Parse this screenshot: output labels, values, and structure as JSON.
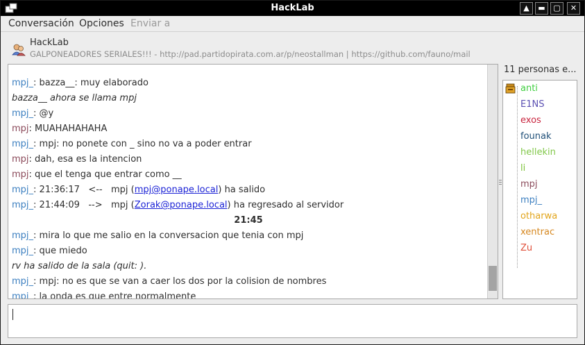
{
  "window": {
    "title": "HackLab",
    "buttons": [
      "▲",
      "▬",
      "▢",
      "✕"
    ]
  },
  "menu": {
    "items": [
      {
        "label": "Conversación",
        "enabled": true
      },
      {
        "label": "Opciones",
        "enabled": true
      },
      {
        "label": "Enviar a",
        "enabled": false
      }
    ]
  },
  "room": {
    "name": "HackLab",
    "topic": "GALPONEADORES SERIALES!!! - http://pad.partidopirata.com.ar/p/neostallman | https://github.com/fauno/mail"
  },
  "messages": [
    {
      "kind": "msg",
      "nick": "mpj_",
      "text": ": bazza__: muy elaborado"
    },
    {
      "kind": "action",
      "text": "bazza__ ahora se llama mpj"
    },
    {
      "kind": "msg",
      "nick": "mpj_",
      "text": ": @y"
    },
    {
      "kind": "msg",
      "nick": "mpj",
      "text": ": MUAHAHAHAHA"
    },
    {
      "kind": "msg",
      "nick": "mpj_",
      "text": ": mpj: no ponete con _ sino no va a poder entrar"
    },
    {
      "kind": "msg",
      "nick": "mpj",
      "text": ": dah, esa es la intencion"
    },
    {
      "kind": "msg",
      "nick": "mpj",
      "text": ": que el tenga que entrar como __"
    },
    {
      "kind": "event",
      "nick": "mpj_",
      "pre": ": 21:36:17   <--   mpj (",
      "link": "mpj@ponape.local",
      "post": ") ha salido"
    },
    {
      "kind": "event",
      "nick": "mpj_",
      "pre": ": 21:44:09   -->   mpj (",
      "link": "Zorak@ponape.local",
      "post": ") ha regresado al servidor"
    },
    {
      "kind": "time",
      "text": "21:45"
    },
    {
      "kind": "msg",
      "nick": "mpj_",
      "text": ": mira lo que me salio en la conversacion que tenia con mpj"
    },
    {
      "kind": "msg",
      "nick": "mpj_",
      "text": ": que miedo"
    },
    {
      "kind": "action",
      "text": "rv ha salido de la sala (quit: )."
    },
    {
      "kind": "msg",
      "nick": "mpj_",
      "text": ": mpj: no es que se van a caer los dos por la colision de nombres"
    },
    {
      "kind": "msg",
      "nick": "mpj_",
      "text": ": la onda es que entre normalmente"
    }
  ],
  "users": {
    "count_label": "11 personas e...",
    "list": [
      {
        "name": "anti",
        "color": "#3fce3f"
      },
      {
        "name": "E1NS",
        "color": "#5a4fb2"
      },
      {
        "name": "exos",
        "color": "#c8233d"
      },
      {
        "name": "founak",
        "color": "#1f4f78"
      },
      {
        "name": "hellekin",
        "color": "#82c84a"
      },
      {
        "name": "li",
        "color": "#7ec23a"
      },
      {
        "name": "mpj",
        "color": "#8b4a5a"
      },
      {
        "name": "mpj_",
        "color": "#3c7fc0"
      },
      {
        "name": "otharwa",
        "color": "#e2a51b"
      },
      {
        "name": "xentrac",
        "color": "#d6871f"
      },
      {
        "name": "Zu",
        "color": "#e0503a"
      }
    ]
  },
  "input": {
    "value": ""
  },
  "colors": {
    "nick_mpj_": "#3c7fc0",
    "nick_mpj": "#8b4a5a",
    "action": "#4aa43c",
    "link": "#1b22d6"
  }
}
